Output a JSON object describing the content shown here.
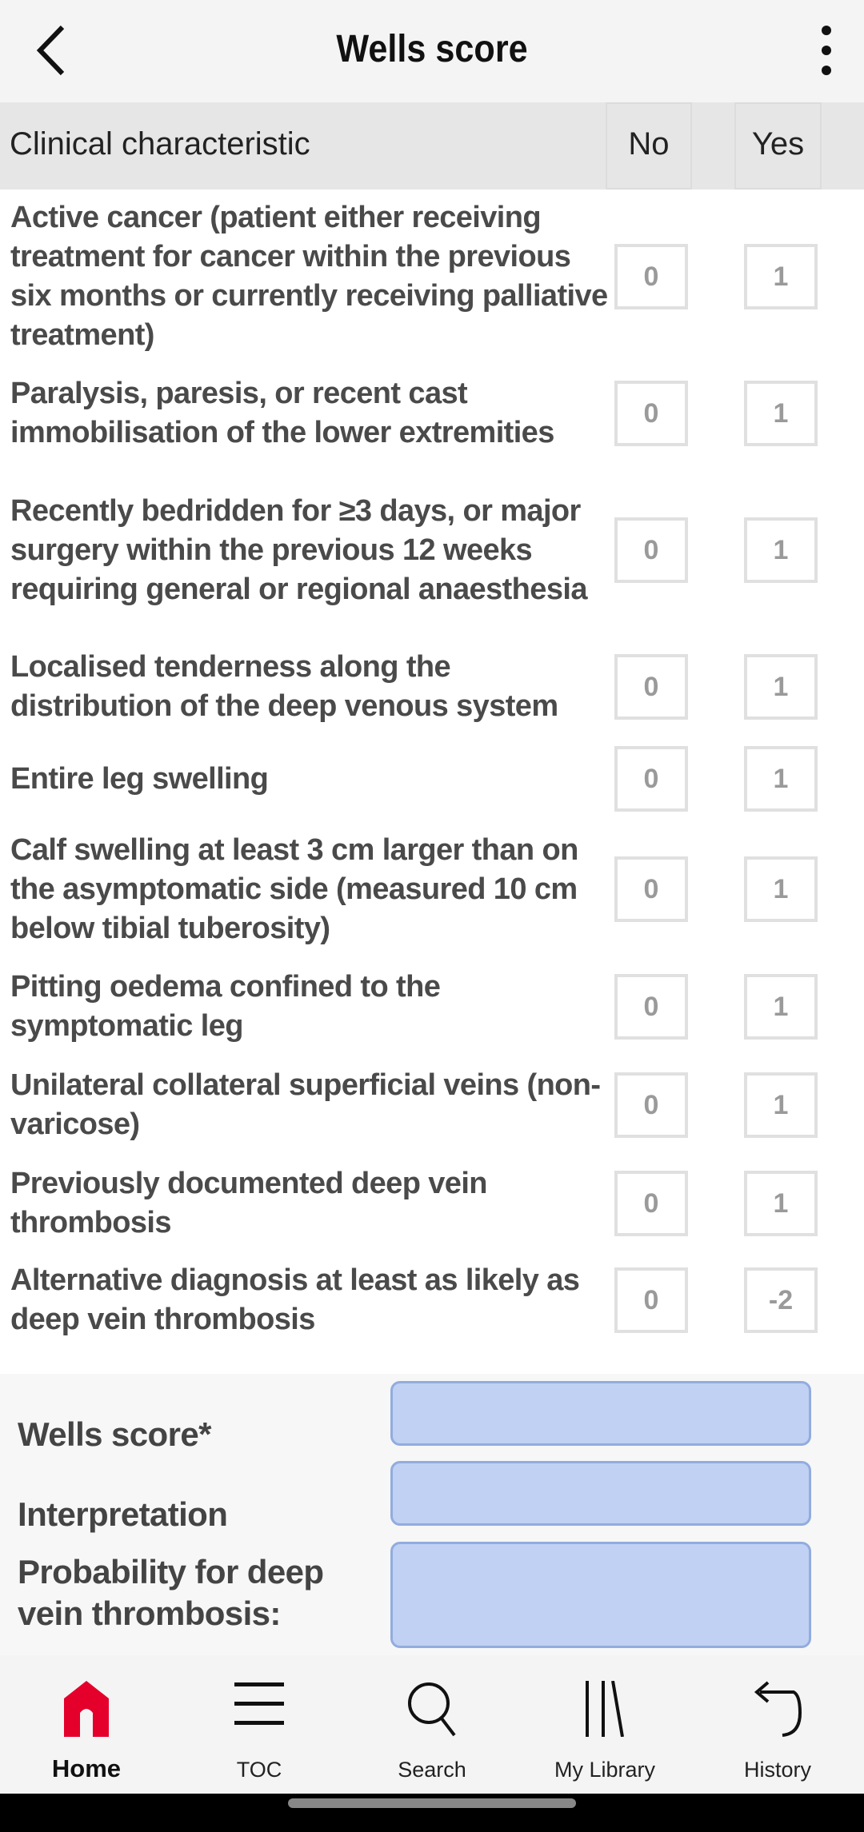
{
  "header": {
    "title": "Wells score",
    "back_icon": "chevron-left-icon",
    "menu_icon": "more-vertical-icon"
  },
  "table": {
    "headers": {
      "characteristic": "Clinical characteristic",
      "no": "No",
      "yes": "Yes"
    },
    "rows": [
      {
        "text": "Active cancer (patient either receiving treatment for cancer within the previous six months or currently receiving palliative treatment)",
        "no": "0",
        "yes": "1"
      },
      {
        "text": "Paralysis, paresis, or recent cast immobilisation of the lower extremities",
        "no": "0",
        "yes": "1"
      },
      {
        "text": "Recently bedridden for ≥3 days, or major surgery within the previous 12 weeks requiring general or regional anaesthesia",
        "no": "0",
        "yes": "1"
      },
      {
        "text": "Localised tenderness along the distribution of the deep venous system",
        "no": "0",
        "yes": "1"
      },
      {
        "text": "Entire leg swelling",
        "no": "0",
        "yes": "1"
      },
      {
        "text": "Calf swelling at least 3 cm larger than on the asymptomatic side (measured 10 cm below tibial tuberosity)",
        "no": "0",
        "yes": "1"
      },
      {
        "text": "Pitting oedema confined to the symptomatic leg",
        "no": "0",
        "yes": "1"
      },
      {
        "text": "Unilateral collateral superficial veins (non-varicose)",
        "no": "0",
        "yes": "1"
      },
      {
        "text": "Previously documented deep vein thrombosis",
        "no": "0",
        "yes": "1"
      },
      {
        "text": "Alternative diagnosis at least as likely as deep vein thrombosis",
        "no": "0",
        "yes": "-2"
      }
    ]
  },
  "results": {
    "wells_score_label": "Wells score*",
    "wells_score_value": "",
    "interpretation_label": "Interpretation",
    "interpretation_value": "",
    "probability_label": "Probability for deep vein thrombosis:",
    "probability_value": ""
  },
  "nav": {
    "items": [
      {
        "label": "Home",
        "icon": "home-icon",
        "active": true
      },
      {
        "label": "TOC",
        "icon": "menu-icon"
      },
      {
        "label": "Search",
        "icon": "search-icon"
      },
      {
        "label": "My Library",
        "icon": "library-icon"
      },
      {
        "label": "History",
        "icon": "history-icon"
      }
    ],
    "accent": "#e4002b"
  }
}
